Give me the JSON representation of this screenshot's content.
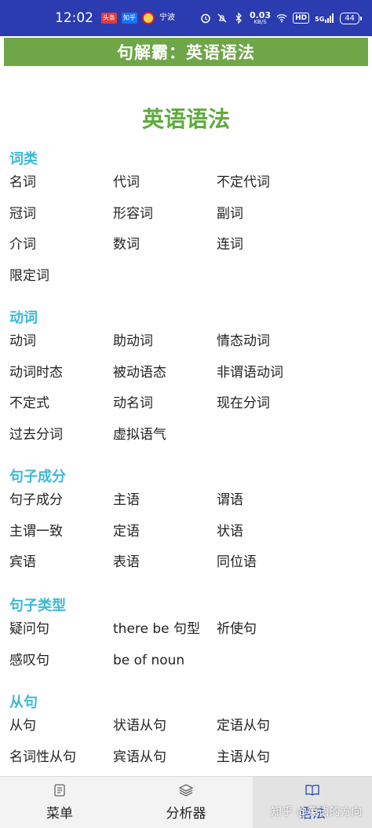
{
  "status_bar": {
    "time": "12:02",
    "notifications": [
      "头条",
      "知乎"
    ],
    "weibo_icon": "weibo-icon",
    "other_icon": "宁波",
    "net_speed_value": "0.03",
    "net_speed_unit": "KB/S",
    "hd": "HD",
    "signal": "5G",
    "battery": "44"
  },
  "header": {
    "title": "句解霸：英语语法"
  },
  "page": {
    "title": "英语语法"
  },
  "sections": [
    {
      "title": "词类",
      "items": [
        "名词",
        "代词",
        "不定代词",
        "冠词",
        "形容词",
        "副词",
        "介词",
        "数词",
        "连词",
        "限定词"
      ]
    },
    {
      "title": "动词",
      "items": [
        "动词",
        "助动词",
        "情态动词",
        "动词时态",
        "被动语态",
        "非谓语动词",
        "不定式",
        "动名词",
        "现在分词",
        "过去分词",
        "虚拟语气"
      ]
    },
    {
      "title": "句子成分",
      "items": [
        "句子成分",
        "主语",
        "谓语",
        "主谓一致",
        "定语",
        "状语",
        "宾语",
        "表语",
        "同位语"
      ]
    },
    {
      "title": "句子类型",
      "items": [
        "疑问句",
        "there be 句型",
        "祈使句",
        "感叹句",
        "be of noun"
      ]
    },
    {
      "title": "从句",
      "items": [
        "从句",
        "状语从句",
        "定语从句",
        "名词性从句",
        "宾语从句",
        "主语从句"
      ]
    }
  ],
  "bottom_nav": {
    "items": [
      {
        "label": "菜单",
        "icon": "document-icon"
      },
      {
        "label": "分析器",
        "icon": "layers-icon"
      },
      {
        "label": "语法",
        "icon": "book-icon",
        "active": true
      }
    ]
  },
  "watermark": "知乎 @英语的方向",
  "colors": {
    "status_bar": "#2b3bb0",
    "header": "#6ea648",
    "page_title": "#5fab3c",
    "section_title": "#3db9d3",
    "active_nav": "#2f4fc0"
  }
}
